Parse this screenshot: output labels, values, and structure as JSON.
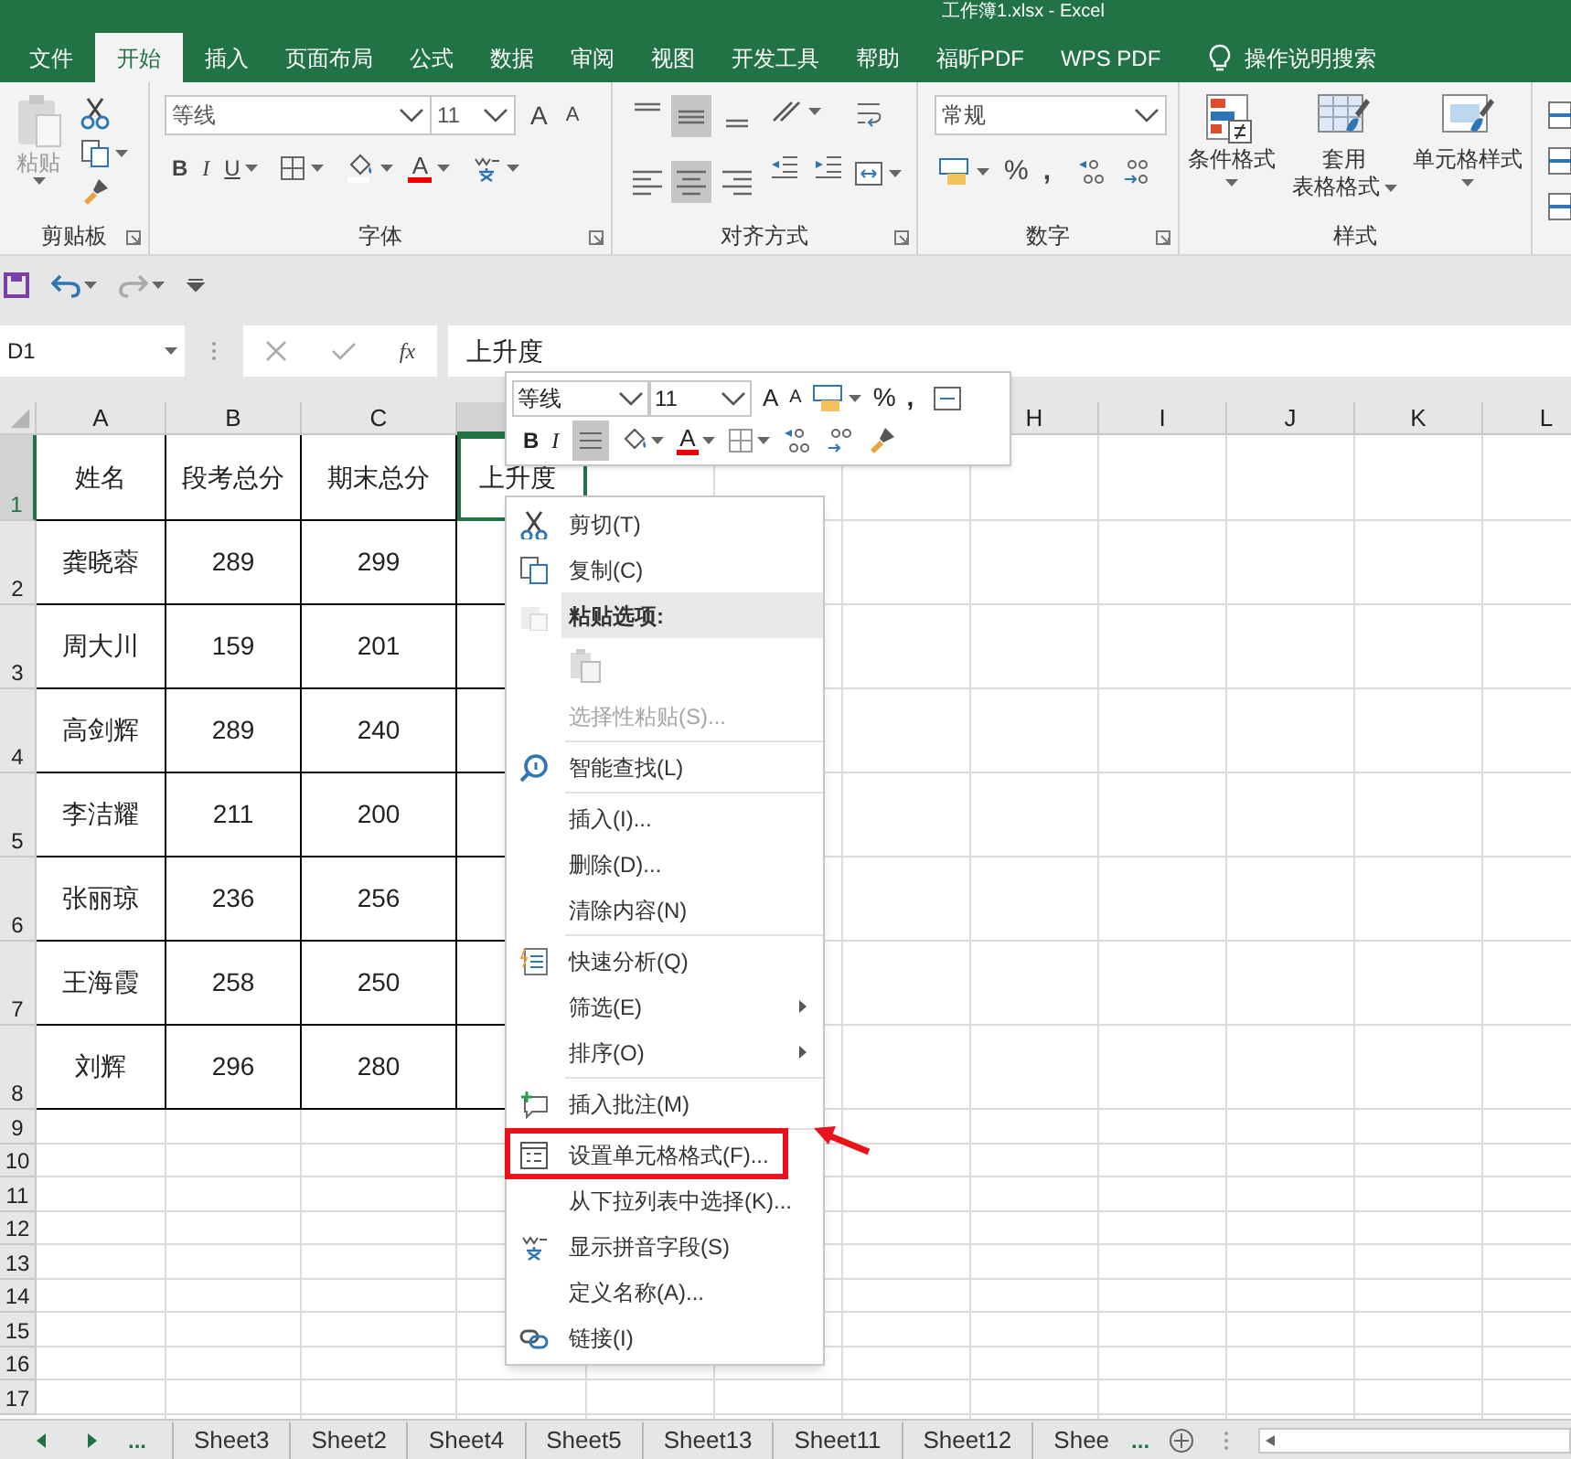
{
  "window": {
    "title": "工作簿1.xlsx - Excel"
  },
  "ribbon_tabs": [
    {
      "label": "文件",
      "selected": false
    },
    {
      "label": "开始",
      "selected": true
    },
    {
      "label": "插入",
      "selected": false
    },
    {
      "label": "页面布局",
      "selected": false
    },
    {
      "label": "公式",
      "selected": false
    },
    {
      "label": "数据",
      "selected": false
    },
    {
      "label": "审阅",
      "selected": false
    },
    {
      "label": "视图",
      "selected": false
    },
    {
      "label": "开发工具",
      "selected": false
    },
    {
      "label": "帮助",
      "selected": false
    },
    {
      "label": "福昕PDF",
      "selected": false
    },
    {
      "label": "WPS PDF",
      "selected": false
    }
  ],
  "tell_me": {
    "label": "操作说明搜索"
  },
  "ribbon": {
    "clipboard": {
      "paste": "粘贴",
      "title": "剪贴板"
    },
    "font": {
      "name": "等线",
      "size": "11",
      "grow": "A",
      "shrink": "A",
      "bold": "B",
      "italic": "I",
      "underline": "U",
      "color_letter": "A",
      "title": "字体"
    },
    "alignment": {
      "buttons": [
        {
          "kind": "top",
          "selected": false
        },
        {
          "kind": "middle",
          "selected": true
        },
        {
          "kind": "bottom",
          "selected": false
        },
        {
          "kind": "left",
          "selected": false
        },
        {
          "kind": "center",
          "selected": true
        },
        {
          "kind": "right",
          "selected": false
        }
      ],
      "title": "对齐方式"
    },
    "number": {
      "format": "常规",
      "percent": "%",
      "comma": ",",
      "title": "数字"
    },
    "styles": {
      "buttons": [
        {
          "lines": [
            "条件格式"
          ],
          "kind": "conditional"
        },
        {
          "lines": [
            "套用",
            "表格格式"
          ],
          "kind": "table"
        },
        {
          "lines": [
            "单元格样式"
          ],
          "kind": "cell"
        }
      ],
      "title": "样式"
    }
  },
  "formula_bar": {
    "name_box": "D1",
    "fx": "fx",
    "content": "上升度"
  },
  "sheet": {
    "columns": [
      {
        "label": "A",
        "selected": false
      },
      {
        "label": "B",
        "selected": false
      },
      {
        "label": "C",
        "selected": false
      },
      {
        "selected": true
      },
      {
        "label": "H",
        "selected": false
      },
      {
        "label": "I",
        "selected": false
      },
      {
        "label": "J",
        "selected": false
      },
      {
        "label": "K",
        "selected": false
      },
      {
        "label": "L",
        "selected": false
      }
    ],
    "rows": [
      {
        "header": "1",
        "selected": true,
        "kind": "header",
        "cells": [
          "姓名",
          "段考总分",
          "期末总分",
          "上升度"
        ]
      },
      {
        "header": "2",
        "selected": false,
        "kind": "data",
        "cells": [
          "龚晓蓉",
          "289",
          "299"
        ]
      },
      {
        "header": "3",
        "selected": false,
        "kind": "data",
        "cells": [
          "周大川",
          "159",
          "201"
        ]
      },
      {
        "header": "4",
        "selected": false,
        "kind": "data",
        "cells": [
          "高剑辉",
          "289",
          "240"
        ]
      },
      {
        "header": "5",
        "selected": false,
        "kind": "data",
        "cells": [
          "李洁耀",
          "211",
          "200"
        ]
      },
      {
        "header": "6",
        "selected": false,
        "kind": "data",
        "cells": [
          "张丽琼",
          "236",
          "256"
        ]
      },
      {
        "header": "7",
        "selected": false,
        "kind": "data",
        "cells": [
          "王海霞",
          "258",
          "250"
        ]
      },
      {
        "header": "8",
        "selected": false,
        "kind": "data",
        "cells": [
          "刘辉",
          "296",
          "280"
        ]
      },
      {
        "header": "9",
        "selected": false,
        "kind": "empty"
      },
      {
        "header": "10",
        "selected": false,
        "kind": "empty"
      },
      {
        "header": "11",
        "selected": false,
        "kind": "empty"
      },
      {
        "header": "12",
        "selected": false,
        "kind": "empty"
      },
      {
        "header": "13",
        "selected": false,
        "kind": "empty"
      },
      {
        "header": "14",
        "selected": false,
        "kind": "empty"
      },
      {
        "header": "15",
        "selected": false,
        "kind": "empty"
      },
      {
        "header": "16",
        "selected": false,
        "kind": "empty"
      },
      {
        "header": "17",
        "selected": false,
        "kind": "empty"
      }
    ]
  },
  "mini_toolbar": {
    "font": "等线",
    "size": "11",
    "grow": "A",
    "shrink": "A",
    "percent": "%",
    "comma": ",",
    "bold": "B",
    "italic": "I",
    "center_selected": true,
    "color_letter": "A"
  },
  "context_menu": {
    "groups": [
      [
        {
          "kind": "cut",
          "label": "剪切(T)",
          "disabled": false,
          "submenu": false,
          "highlighted": false
        },
        {
          "kind": "copy",
          "label": "复制(C)",
          "disabled": false,
          "submenu": false,
          "highlighted": false
        },
        {
          "kind": "heading",
          "label": "粘贴选项:"
        },
        {
          "kind": "paste-options"
        },
        {
          "kind": "plain",
          "label": "选择性粘贴(S)...",
          "disabled": true,
          "submenu": false,
          "highlighted": false
        }
      ],
      [
        {
          "kind": "lookup",
          "label": "智能查找(L)",
          "disabled": false,
          "submenu": false,
          "highlighted": false
        }
      ],
      [
        {
          "kind": "plain",
          "label": "插入(I)...",
          "disabled": false,
          "submenu": false,
          "highlighted": false
        },
        {
          "kind": "plain",
          "label": "删除(D)...",
          "disabled": false,
          "submenu": false,
          "highlighted": false
        },
        {
          "kind": "plain",
          "label": "清除内容(N)",
          "disabled": false,
          "submenu": false,
          "highlighted": false
        }
      ],
      [
        {
          "kind": "analysis",
          "label": "快速分析(Q)",
          "disabled": false,
          "submenu": false,
          "highlighted": false
        },
        {
          "kind": "plain",
          "label": "筛选(E)",
          "disabled": false,
          "submenu": true,
          "highlighted": false
        },
        {
          "kind": "plain",
          "label": "排序(O)",
          "disabled": false,
          "submenu": true,
          "highlighted": false
        }
      ],
      [
        {
          "kind": "comment",
          "label": "插入批注(M)",
          "disabled": false,
          "submenu": false,
          "highlighted": false
        }
      ],
      [
        {
          "kind": "format",
          "label": "设置单元格格式(F)...",
          "disabled": false,
          "submenu": false,
          "highlighted": true
        },
        {
          "kind": "plain",
          "label": "从下拉列表中选择(K)...",
          "disabled": false,
          "submenu": false,
          "highlighted": false
        },
        {
          "kind": "phonetic",
          "label": "显示拼音字段(S)",
          "disabled": false,
          "submenu": false,
          "highlighted": false
        },
        {
          "kind": "plain",
          "label": "定义名称(A)...",
          "disabled": false,
          "submenu": false,
          "highlighted": false
        },
        {
          "kind": "link",
          "label": "链接(I)",
          "disabled": false,
          "submenu": false,
          "highlighted": false
        }
      ]
    ]
  },
  "sheet_tabs": {
    "more_left": "...",
    "tabs": [
      {
        "label": "Sheet3",
        "selected": false
      },
      {
        "label": "Sheet2",
        "selected": false
      },
      {
        "label": "Sheet4",
        "selected": false
      },
      {
        "label": "Sheet5",
        "selected": false
      },
      {
        "label": "Sheet13",
        "selected": false
      },
      {
        "label": "Sheet11",
        "selected": false
      },
      {
        "label": "Sheet12",
        "selected": false
      },
      {
        "label": "Shee",
        "selected": false
      }
    ],
    "more_right": "..."
  }
}
